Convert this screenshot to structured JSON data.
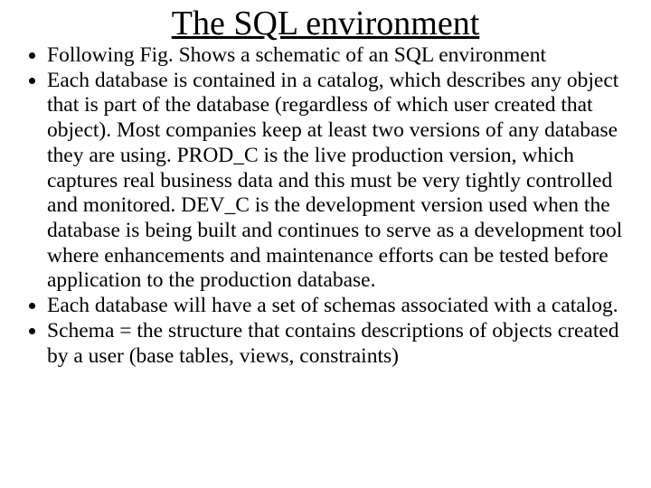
{
  "title": "The SQL environment",
  "bullets": [
    "Following Fig. Shows a schematic of an SQL environment",
    "Each database is contained in a catalog, which describes any object that is part of the database (regardless of which user created that object). Most companies keep at least two versions of any database they are using. PROD_C is the live production version, which captures real business data and this must be very tightly controlled and monitored. DEV_C is the development version used when the database is being built and continues to serve as a development tool where enhancements and maintenance efforts can be tested before application to the production database.",
    "Each database will have a set of schemas associated with a catalog.",
    "Schema = the structure that contains descriptions of objects created by a user (base tables, views, constraints)"
  ]
}
